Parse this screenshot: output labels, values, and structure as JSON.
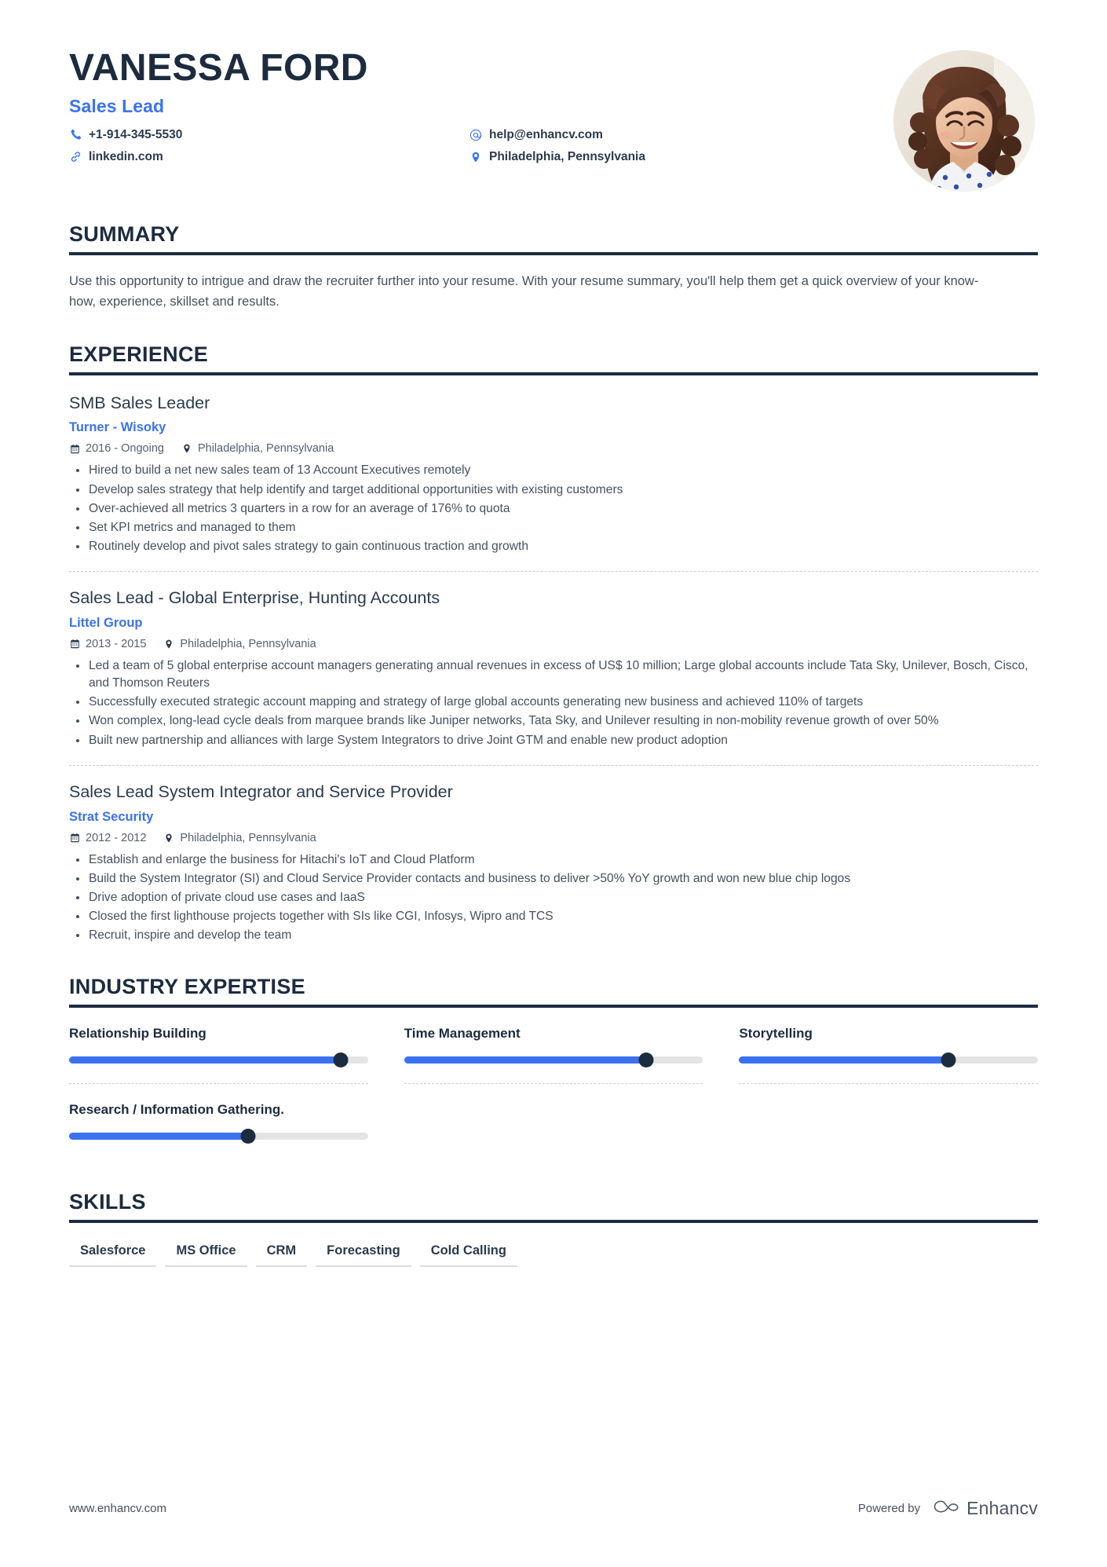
{
  "header": {
    "name": "VANESSA FORD",
    "job_title": "Sales Lead",
    "accent_color": "#3a72f0",
    "dark_color": "#1d2b3f",
    "contacts": [
      {
        "icon": "phone-icon",
        "text": "+1-914-345-5530"
      },
      {
        "icon": "at-icon",
        "text": "help@enhancv.com"
      },
      {
        "icon": "link-icon",
        "text": "linkedin.com"
      },
      {
        "icon": "location-pin-icon",
        "text": "Philadelphia, Pennsylvania"
      }
    ],
    "avatar_alt": "Portrait photo of smiling woman with curly brown hair"
  },
  "summary": {
    "title": "SUMMARY",
    "text": "Use this opportunity to intrigue and draw the recruiter further into your resume. With your resume summary, you'll help them get a quick overview of your know-how, experience, skillset and results."
  },
  "experience": {
    "title": "EXPERIENCE",
    "jobs": [
      {
        "role": "SMB Sales Leader",
        "company": "Turner - Wisoky",
        "dates": "2016 - Ongoing",
        "location": "Philadelphia, Pennsylvania",
        "bullets": [
          "Hired to build a net new sales team of 13 Account Executives remotely",
          "Develop sales strategy that help identify and target additional opportunities with existing customers",
          "Over-achieved all metrics 3 quarters in a row for an average of 176% to quota",
          "Set KPI metrics and managed to them",
          "Routinely develop and pivot sales strategy to gain continuous traction and growth"
        ]
      },
      {
        "role": "Sales Lead - Global Enterprise, Hunting Accounts",
        "company": "Littel Group",
        "dates": "2013 - 2015",
        "location": "Philadelphia, Pennsylvania",
        "bullets": [
          "Led a team of 5 global enterprise account managers generating annual revenues in excess of US$ 10 million; Large global accounts include Tata Sky, Unilever, Bosch, Cisco, and Thomson Reuters",
          "Successfully executed strategic account mapping and strategy of large global accounts generating new business and achieved 110% of targets",
          "Won complex, long-lead cycle deals from marquee brands like Juniper networks, Tata Sky, and Unilever resulting in non-mobility revenue growth of over 50%",
          "Built new partnership and alliances with large System Integrators to drive Joint GTM and enable new product adoption"
        ]
      },
      {
        "role": "Sales Lead System Integrator and Service Provider",
        "company": "Strat Security",
        "dates": "2012 - 2012",
        "location": "Philadelphia, Pennsylvania",
        "bullets": [
          "Establish and enlarge the business for Hitachi's IoT and Cloud Platform",
          "Build the System Integrator (SI) and Cloud Service Provider contacts and business to deliver >50% YoY growth and won new blue chip logos",
          "Drive adoption of private cloud use cases and IaaS",
          "Closed the first lighthouse projects together with SIs like CGI, Infosys, Wipro and TCS",
          "Recruit, inspire and develop the team"
        ]
      }
    ]
  },
  "industry_expertise": {
    "title": "INDUSTRY EXPERTISE",
    "items": [
      {
        "label": "Relationship Building",
        "value": 91
      },
      {
        "label": "Time Management",
        "value": 81
      },
      {
        "label": "Storytelling",
        "value": 70
      },
      {
        "label": "Research / Information Gathering.",
        "value": 60
      }
    ]
  },
  "skills": {
    "title": "SKILLS",
    "items": [
      "Salesforce",
      "MS Office",
      "CRM",
      "Forecasting",
      "Cold Calling"
    ]
  },
  "footer": {
    "url": "www.enhancv.com",
    "powered_by": "Powered by",
    "brand": "Enhancv"
  }
}
